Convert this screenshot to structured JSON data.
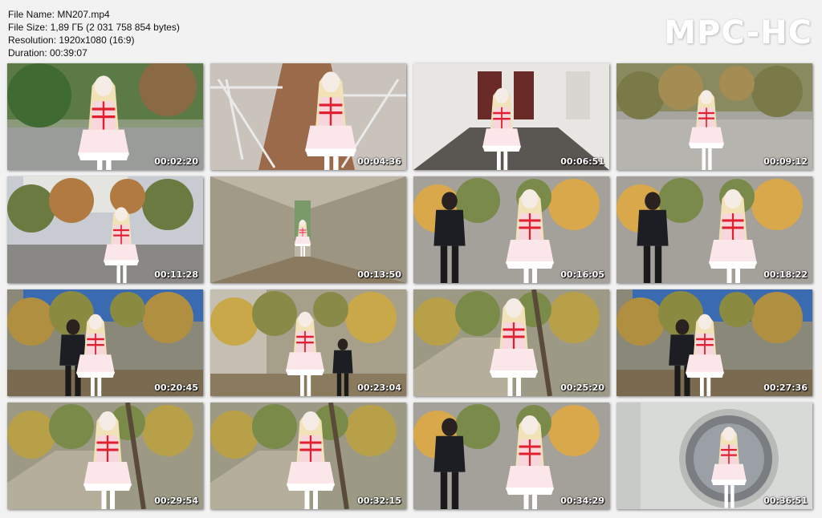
{
  "file_info": {
    "name": "File Name: MN207.mp4",
    "size": "File Size: 1,89 ГБ (2 031 758 854 bytes)",
    "resolution": "Resolution: 1920x1080 (16:9)",
    "duration": "Duration: 00:39:07"
  },
  "logo": "MPC-HC",
  "thumbnails": [
    {
      "time": "00:02:20",
      "scene": "street-park"
    },
    {
      "time": "00:04:36",
      "scene": "stairs"
    },
    {
      "time": "00:06:51",
      "scene": "empty-room"
    },
    {
      "time": "00:09:12",
      "scene": "plaza"
    },
    {
      "time": "00:11:28",
      "scene": "road-buildings"
    },
    {
      "time": "00:13:50",
      "scene": "alley"
    },
    {
      "time": "00:16:05",
      "scene": "two-people-trees"
    },
    {
      "time": "00:18:22",
      "scene": "two-people-trees"
    },
    {
      "time": "00:20:45",
      "scene": "blue-wall"
    },
    {
      "time": "00:23:04",
      "scene": "ruins-crouch"
    },
    {
      "time": "00:25:20",
      "scene": "ruins-tree"
    },
    {
      "time": "00:27:36",
      "scene": "blue-wall"
    },
    {
      "time": "00:29:54",
      "scene": "ruins-tree"
    },
    {
      "time": "00:32:15",
      "scene": "ruins-tree"
    },
    {
      "time": "00:34:29",
      "scene": "two-people-trees"
    },
    {
      "time": "00:36:51",
      "scene": "drum"
    }
  ]
}
